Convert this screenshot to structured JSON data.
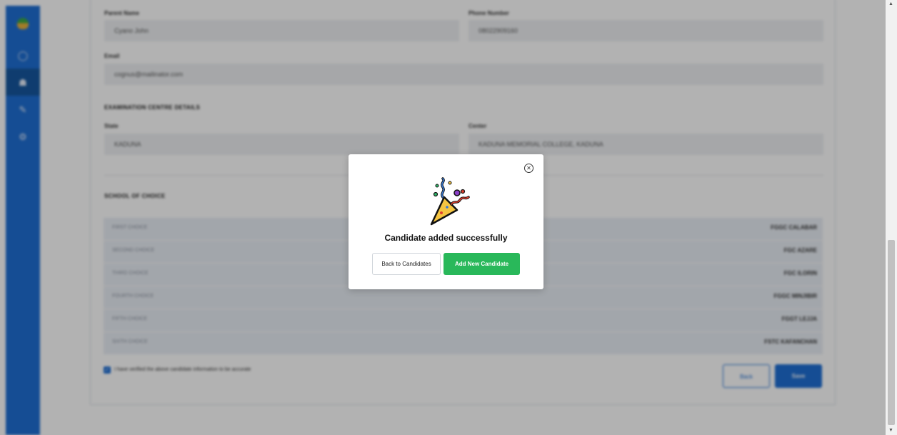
{
  "sidebar": {
    "icons": [
      "logo-icon",
      "dashboard-icon",
      "candidates-icon",
      "edit-icon",
      "settings-icon"
    ]
  },
  "form": {
    "parent_name_label": "Parent Name",
    "parent_name_value": "Cyano John",
    "phone_label": "Phone Number",
    "phone_value": "08022909160",
    "email_label": "Email",
    "email_value": "cognus@mailinator.com",
    "exam_section_title": "EXAMINATION CENTRE DETAILS",
    "state_label": "State",
    "state_value": "KADUNA",
    "center_label": "Center",
    "center_value": "KADUNA MEMORIAL COLLEGE, KADUNA",
    "school_section_title": "SCHOOL OF CHOICE",
    "choices": [
      {
        "label": "FIRST CHOICE",
        "value": "FGGC CALABAR"
      },
      {
        "label": "SECOND CHOICE",
        "value": "FGC AZARE"
      },
      {
        "label": "THIRD CHOICE",
        "value": "FGC ILORIN"
      },
      {
        "label": "FOURTH CHOICE",
        "value": "FGGC MINJIBIR"
      },
      {
        "label": "FIFTH CHOICE",
        "value": "FGGT LEJJA"
      },
      {
        "label": "SIXTH CHOICE",
        "value": "FSTC KAFANCHAN"
      }
    ],
    "verify_text": "I have verified the above candidate information to be accurate",
    "back_label": "Back",
    "save_label": "Save"
  },
  "modal": {
    "title": "Candidate added successfully",
    "back_button": "Back to Candidates",
    "add_button": "Add New Candidate",
    "close_symbol": "✕",
    "accent_green": "#29b85a"
  }
}
